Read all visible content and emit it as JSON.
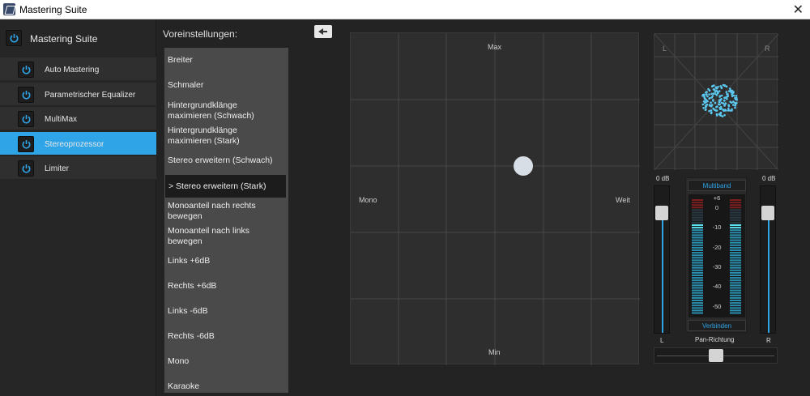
{
  "window": {
    "title": "Mastering Suite"
  },
  "sidebar": {
    "title": "Mastering Suite",
    "items": [
      {
        "label": "Auto Mastering",
        "active": false
      },
      {
        "label": "Parametrischer Equalizer",
        "active": false
      },
      {
        "label": "MultiMax",
        "active": false
      },
      {
        "label": "Stereoprozessor",
        "active": true
      },
      {
        "label": "Limiter",
        "active": false
      }
    ]
  },
  "presets": {
    "label": "Voreinstellungen:",
    "selected": 5,
    "items": [
      "Breiter",
      "Schmaler",
      "Hintergrundklänge\nmaximieren (Schwach)",
      "Hintergrundklänge\nmaximieren (Stark)",
      "Stereo erweitern (Schwach)",
      "> Stereo erweitern (Stark)",
      "Monoanteil nach rechts\nbewegen",
      "Monoanteil nach links\nbewegen",
      "Links +6dB",
      "Rechts +6dB",
      "Links -6dB",
      "Rechts -6dB",
      "Mono",
      "Karaoke"
    ]
  },
  "stage": {
    "top": "Max",
    "bottom": "Min",
    "left": "Mono",
    "right": "Weit"
  },
  "scope": {
    "left": "L",
    "right": "R"
  },
  "faders": {
    "left": {
      "db": "0 dB",
      "channel": "L",
      "level": 0.87
    },
    "right": {
      "db": "0 dB",
      "channel": "R",
      "level": 0.87
    }
  },
  "meter": {
    "top_button": "Multiband",
    "bottom_button": "Verbinden",
    "scale": [
      "+6",
      "0",
      "-10",
      "-20",
      "-30",
      "-40",
      "-50"
    ]
  },
  "pan": {
    "label": "Pan-Richtung",
    "position": 0.5
  },
  "colors": {
    "accent": "#2fa4e7",
    "meter_cyan": "#5ce1f0",
    "meter_red": "#7a1e1e"
  }
}
